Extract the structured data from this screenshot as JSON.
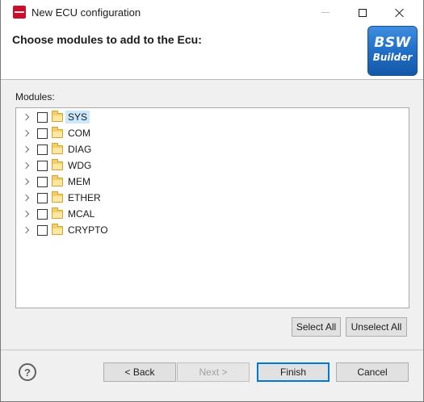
{
  "window": {
    "title": "New ECU configuration",
    "icon": "app-icon",
    "controls": [
      "minimize-icon",
      "maximize-icon",
      "close-icon"
    ]
  },
  "header": {
    "title": "Choose modules to add to the Ecu:",
    "logo": {
      "line1": "BSW",
      "line2": "Builder",
      "color": "#1f6cc4"
    }
  },
  "modules": {
    "label": "Modules:",
    "items": [
      {
        "label": "SYS",
        "checked": false,
        "selected": true
      },
      {
        "label": "COM",
        "checked": false,
        "selected": false
      },
      {
        "label": "DIAG",
        "checked": false,
        "selected": false
      },
      {
        "label": "WDG",
        "checked": false,
        "selected": false
      },
      {
        "label": "MEM",
        "checked": false,
        "selected": false
      },
      {
        "label": "ETHER",
        "checked": false,
        "selected": false
      },
      {
        "label": "MCAL",
        "checked": false,
        "selected": false
      },
      {
        "label": "CRYPTO",
        "checked": false,
        "selected": false
      }
    ],
    "select_all_label": "Select All",
    "unselect_all_label": "Unselect All"
  },
  "footer": {
    "help_icon": "?",
    "back_label": "< Back",
    "next_label": "Next >",
    "finish_label": "Finish",
    "cancel_label": "Cancel"
  },
  "colors": {
    "selection": "#cce8ff",
    "accent": "#0078d7",
    "folder": "#f3cf6b"
  }
}
